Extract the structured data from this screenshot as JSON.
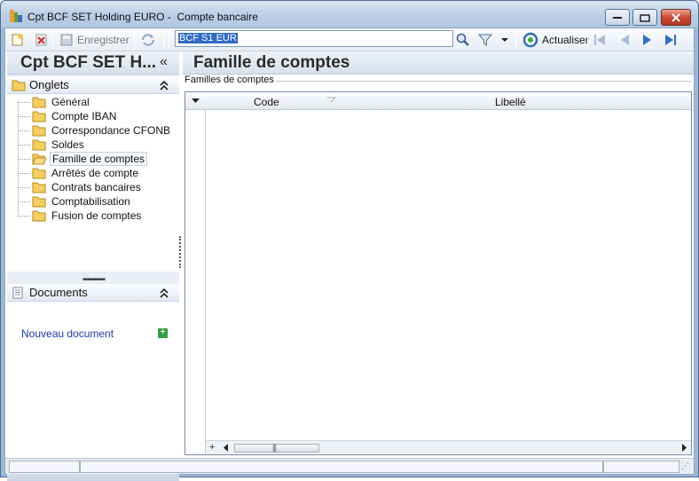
{
  "window": {
    "title": "Cpt BCF SET Holding EURO -  Compte bancaire"
  },
  "toolbar": {
    "save_label": "Enregistrer",
    "search_value": "BCF S1 EUR",
    "refresh_label": "Actualiser"
  },
  "left_panel": {
    "title": "Cpt BCF SET H...",
    "collapse_glyph": "«",
    "onglets": {
      "header": "Onglets",
      "items": [
        {
          "label": "Général"
        },
        {
          "label": "Compte IBAN"
        },
        {
          "label": "Correspondance CFONB"
        },
        {
          "label": "Soldes"
        },
        {
          "label": "Famille de comptes",
          "selected": true
        },
        {
          "label": "Arrêtés de compte"
        },
        {
          "label": "Contrats bancaires"
        },
        {
          "label": "Comptabilisation"
        },
        {
          "label": "Fusion de comptes"
        }
      ]
    },
    "documents": {
      "header": "Documents",
      "new_document": "Nouveau document"
    }
  },
  "main": {
    "title": "Famille de comptes",
    "group_label": "Familles de comptes",
    "grid": {
      "columns": [
        "Code",
        "Libellé"
      ],
      "rows": []
    }
  },
  "colors": {
    "accent": "#3169c6",
    "link": "#1c3aa9",
    "window_frame": "#9fb8d4",
    "add_green": "#2f9e3e"
  },
  "icons": {
    "toolbar": [
      "new-record-icon",
      "delete-icon",
      "save-icon",
      "refresh-icon",
      "search-icon",
      "filter-icon",
      "dropdown-icon",
      "actualiser-icon",
      "first-icon",
      "previous-icon",
      "next-icon",
      "last-icon"
    ]
  }
}
